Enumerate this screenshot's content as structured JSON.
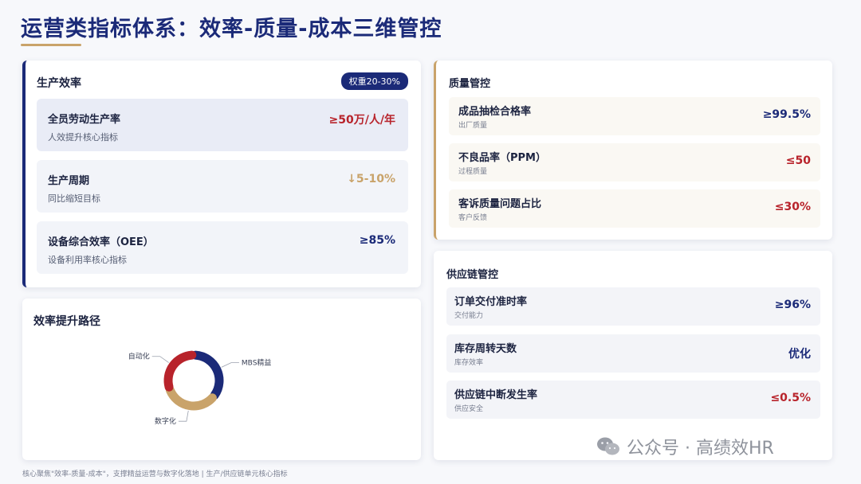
{
  "title": "运营类指标体系：效率-质量-成本三维管控",
  "efficiency": {
    "title": "生产效率",
    "badge": "权重20-30%",
    "items": [
      {
        "name": "全员劳动生产率",
        "desc": "人效提升核心指标",
        "value": "≥50万/人/年",
        "color": "#b8232b"
      },
      {
        "name": "生产周期",
        "desc": "同比缩短目标",
        "value": "↓5-10%",
        "color": "#c9a36a"
      },
      {
        "name": "设备综合效率（OEE）",
        "desc": "设备利用率核心指标",
        "value": "≥85%",
        "color": "#1b2a78"
      }
    ]
  },
  "path": {
    "title": "效率提升路径",
    "chart_data": {
      "type": "pie",
      "categories": [
        "MBS精益",
        "数字化",
        "自动化"
      ],
      "values": [
        36,
        34,
        30
      ],
      "colors": [
        "#1b2a78",
        "#c9a36a",
        "#b8232b"
      ]
    }
  },
  "quality": {
    "title": "质量管控",
    "items": [
      {
        "name": "成品抽检合格率",
        "desc": "出厂质量",
        "value": "≥99.5%",
        "color": "#1b2a78"
      },
      {
        "name": "不良品率（PPM）",
        "desc": "过程质量",
        "value": "≤50",
        "color": "#b8232b"
      },
      {
        "name": "客诉质量问题占比",
        "desc": "客户反馈",
        "value": "≤30%",
        "color": "#b8232b"
      }
    ]
  },
  "supply": {
    "title": "供应链管控",
    "items": [
      {
        "name": "订单交付准时率",
        "desc": "交付能力",
        "value": "≥96%",
        "color": "#1b2a78"
      },
      {
        "name": "库存周转天数",
        "desc": "库存效率",
        "value": "优化",
        "color": "#1b2a78"
      },
      {
        "name": "供应链中断发生率",
        "desc": "供应安全",
        "value": "≤0.5%",
        "color": "#b8232b"
      }
    ]
  },
  "footer": "核心聚焦\"效率-质量-成本\"，支撑精益运营与数字化落地 | 生产/供应链单元核心指标",
  "watermark": "公众号 · 高绩效HR"
}
